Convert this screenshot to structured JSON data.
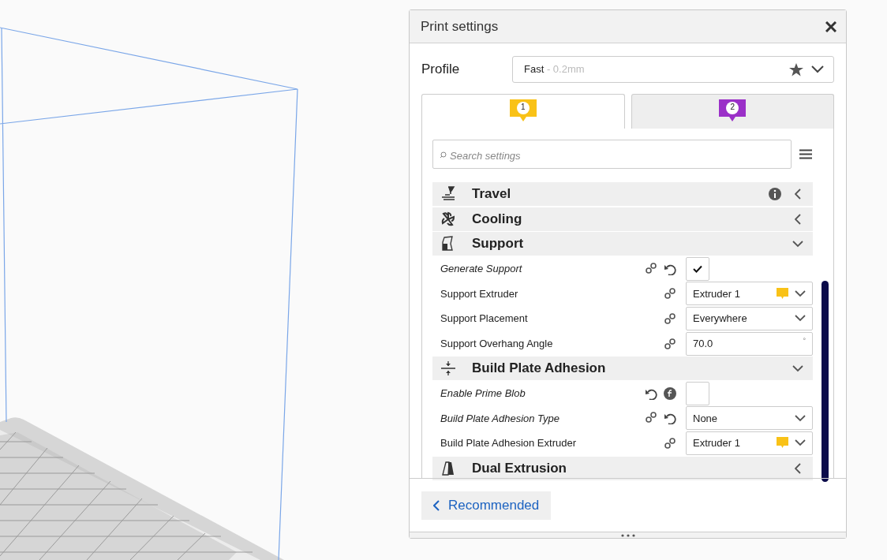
{
  "window": {
    "title": "Print settings"
  },
  "profile": {
    "label": "Profile",
    "name": "Fast",
    "detail": "- 0.2mm"
  },
  "tabs": [
    {
      "badge": "1",
      "color": "#f9c217",
      "selected": true
    },
    {
      "badge": "2",
      "color": "#9b30c8",
      "selected": false
    }
  ],
  "search": {
    "placeholder": "Search settings"
  },
  "settings": [
    {
      "kind": "category",
      "title": "Travel",
      "expanded": false,
      "info": true
    },
    {
      "kind": "category",
      "title": "Cooling",
      "expanded": false,
      "info": false
    },
    {
      "kind": "category",
      "title": "Support",
      "expanded": true,
      "info": false
    },
    {
      "kind": "setting",
      "label": "Generate Support",
      "modified": true,
      "linked": true,
      "reset": true,
      "formula": false,
      "control": {
        "kind": "checkbox",
        "checked": true
      }
    },
    {
      "kind": "setting",
      "label": "Support Extruder",
      "modified": false,
      "linked": true,
      "reset": false,
      "formula": false,
      "control": {
        "kind": "select",
        "value": "Extruder 1",
        "color": "#f9c217"
      }
    },
    {
      "kind": "setting",
      "label": "Support Placement",
      "modified": false,
      "linked": true,
      "reset": false,
      "formula": false,
      "control": {
        "kind": "select",
        "value": "Everywhere"
      }
    },
    {
      "kind": "setting",
      "label": "Support Overhang Angle",
      "modified": false,
      "linked": true,
      "reset": false,
      "formula": false,
      "control": {
        "kind": "number",
        "value": "70.0",
        "unit": "°"
      }
    },
    {
      "kind": "category",
      "title": "Build Plate Adhesion",
      "expanded": true,
      "info": false
    },
    {
      "kind": "setting",
      "label": "Enable Prime Blob",
      "modified": true,
      "linked": false,
      "reset": true,
      "formula": true,
      "control": {
        "kind": "checkbox",
        "checked": false
      }
    },
    {
      "kind": "setting",
      "label": "Build Plate Adhesion Type",
      "modified": true,
      "linked": true,
      "reset": true,
      "formula": false,
      "control": {
        "kind": "select",
        "value": "None"
      }
    },
    {
      "kind": "setting",
      "label": "Build Plate Adhesion Extruder",
      "modified": false,
      "linked": true,
      "reset": false,
      "formula": false,
      "control": {
        "kind": "select",
        "value": "Extruder 1",
        "color": "#f9c217"
      }
    },
    {
      "kind": "category",
      "title": "Dual Extrusion",
      "expanded": false,
      "info": false
    }
  ],
  "footer": {
    "button": "Recommended"
  }
}
